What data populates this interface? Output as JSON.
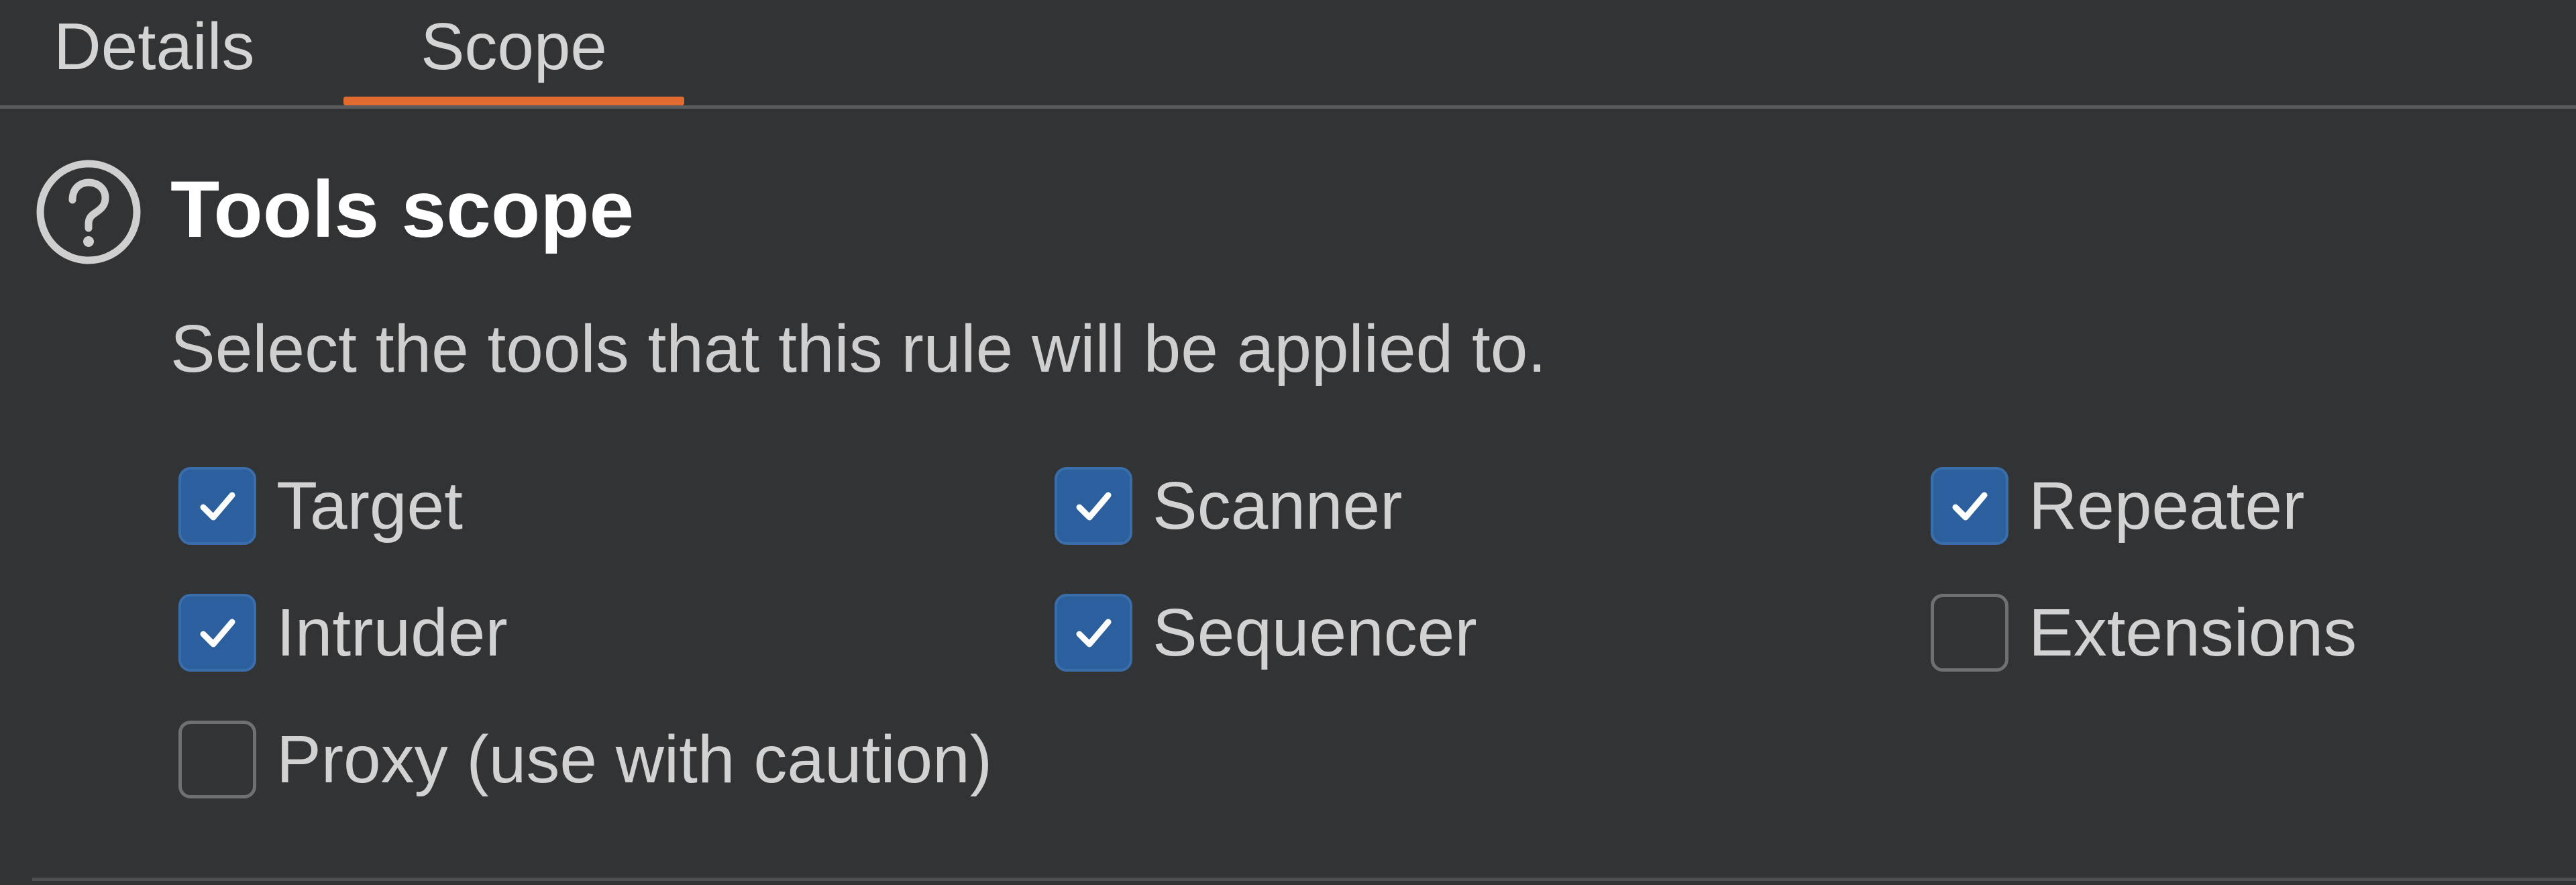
{
  "tabs": [
    {
      "label": "Details",
      "active": false
    },
    {
      "label": "Scope",
      "active": true
    }
  ],
  "colors": {
    "background": "#323335",
    "accent": "#e16a2e",
    "checkbox_checked": "#2b5f9e"
  },
  "section": {
    "icon": "help-circle-icon",
    "title": "Tools scope",
    "description": "Select the tools that this rule will be applied to."
  },
  "tools": [
    {
      "label": "Target",
      "checked": true
    },
    {
      "label": "Scanner",
      "checked": true
    },
    {
      "label": "Repeater",
      "checked": true
    },
    {
      "label": "Intruder",
      "checked": true
    },
    {
      "label": "Sequencer",
      "checked": true
    },
    {
      "label": "Extensions",
      "checked": false
    },
    {
      "label": "Proxy (use with caution)",
      "checked": false
    }
  ]
}
